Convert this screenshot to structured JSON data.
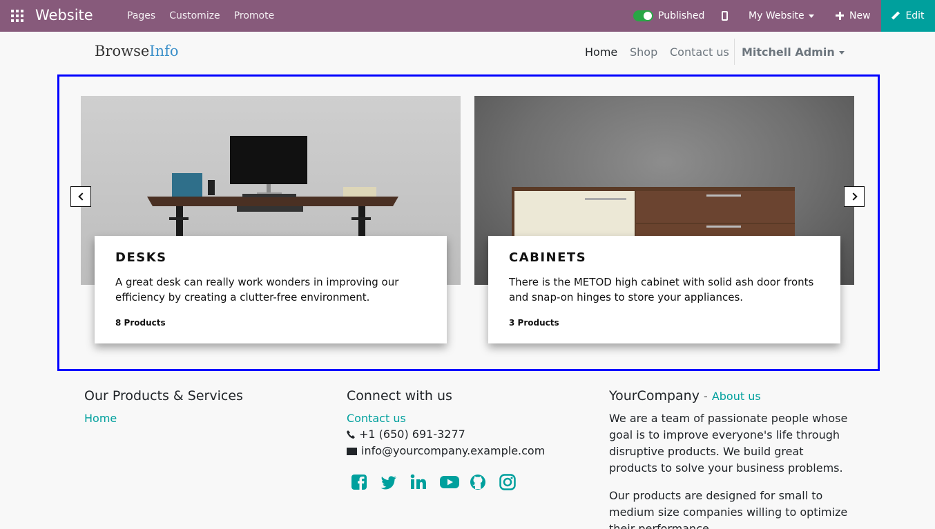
{
  "topbar": {
    "app_name": "Website",
    "menu": [
      "Pages",
      "Customize",
      "Promote"
    ],
    "published_label": "Published",
    "website_label": "My Website",
    "new_label": "New",
    "edit_label": "Edit",
    "bar_color": "#875a7b",
    "edit_color": "#00a09d"
  },
  "header": {
    "logo_part1": "Browse",
    "logo_part2": "Info",
    "nav": {
      "home": "Home",
      "shop": "Shop",
      "contact": "Contact us"
    },
    "user": "Mitchell Admin"
  },
  "carousel": {
    "cards": [
      {
        "title": "DESKS",
        "description": "A great desk can really work wonders in improving our efficiency by creating a clutter-free environment.",
        "count": "8 Products"
      },
      {
        "title": "CABINETS",
        "description": "There is the METOD high cabinet with solid ash door fronts and snap-on hinges to store your appliances.",
        "count": "3 Products"
      }
    ]
  },
  "footer": {
    "products_title": "Our Products & Services",
    "products_link": "Home",
    "connect_title": "Connect with us",
    "contact_link": "Contact us",
    "phone": "+1 (650) 691-3277",
    "email": "info@yourcompany.example.com",
    "social_icons": [
      "facebook-icon",
      "twitter-icon",
      "linkedin-icon",
      "youtube-icon",
      "github-icon",
      "instagram-icon"
    ],
    "company_title": "YourCompany",
    "company_dash": "-",
    "about_link": "About us",
    "about_para1": "We are a team of passionate people whose goal is to improve everyone's life through disruptive products. We build great products to solve your business problems.",
    "about_para2": "Our products are designed for small to medium size companies willing to optimize their performance."
  }
}
